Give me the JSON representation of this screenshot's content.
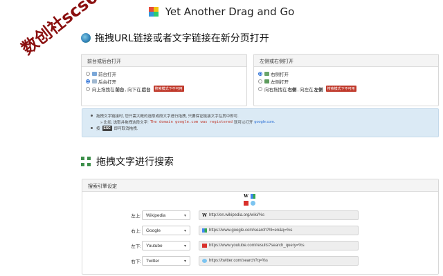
{
  "watermark": "数创社scs66",
  "app_title": "Yet Another Drag and Go",
  "section1_title": "拖拽URL链接或者文字链接在新分页打开",
  "panel_left": {
    "header": "前台或后台打开",
    "options": [
      {
        "label": "前台打开",
        "selected": false
      },
      {
        "label": "后台打开",
        "selected": true
      },
      {
        "prefix": "向上拖拽在",
        "bold1": "前台",
        "mid": ", 向下在",
        "bold2": "后台",
        "badge": "搜索模式下不可用",
        "selected": false
      }
    ]
  },
  "panel_right": {
    "header": "左侧或右侧打开",
    "options": [
      {
        "label": "右侧打开",
        "selected": true
      },
      {
        "label": "左侧打开",
        "selected": false
      },
      {
        "prefix": "向右拖拽在",
        "bold1": "右侧",
        "mid": ", 向左在",
        "bold2": "左侧",
        "badge": "搜索模式下不可用",
        "selected": false
      }
    ]
  },
  "info": {
    "line1": "拖拽文字链接时, 您只需大概的选取或段文字进行拖拽, 只要保证链接文字在其中即可.",
    "line2_prefix": "» 比如, 选取并拖拽这段文字:",
    "line2_code": "The domain google.com was registered",
    "line2_mid": "就可以打开",
    "line2_link": "google.com.",
    "line3_prefix": "按",
    "line3_key": "ESC",
    "line3_suffix": "即可取消拖拽."
  },
  "section2_title": "拖拽文字进行搜索",
  "engine_panel": {
    "header": "搜索引擎设定",
    "rows": [
      {
        "label": "左上:",
        "engine": "Wikipedia",
        "url": "http://en.wikipedia.org/wiki/%s",
        "icon": "wikipedia-icon"
      },
      {
        "label": "右上:",
        "engine": "Google",
        "url": "https://www.google.com/search?hl=en&q=%s",
        "icon": "google-icon"
      },
      {
        "label": "左下:",
        "engine": "Youtube",
        "url": "https://www.youtube.com/results?search_query=%s",
        "icon": "youtube-icon"
      },
      {
        "label": "右下:",
        "engine": "Twitter",
        "url": "https://twitter.com/search?q=%s",
        "icon": "twitter-icon"
      }
    ]
  },
  "colors": {
    "accent_blue": "#2a6fd6",
    "badge_red": "#c0392b",
    "info_bg": "#dbeaf5",
    "watermark": "#8b1010",
    "puzzle_green": "#3d8f4a"
  }
}
